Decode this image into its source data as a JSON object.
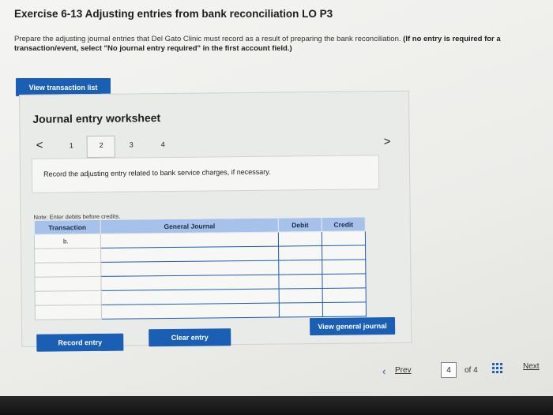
{
  "header": {
    "title": "Exercise 6-13 Adjusting entries from bank reconciliation LO P3",
    "instructions_plain": "Prepare the adjusting journal entries that Del Gato Clinic must record as a result of preparing the bank reconciliation.",
    "instructions_bold": "(If no entry is required for a transaction/event, select \"No journal entry required\" in the first account field.)"
  },
  "buttons": {
    "view_transaction_list": "View transaction list",
    "record_entry": "Record entry",
    "clear_entry": "Clear entry",
    "view_general_journal": "View general journal"
  },
  "worksheet": {
    "title": "Journal entry worksheet",
    "pages": [
      "1",
      "2",
      "3",
      "4"
    ],
    "active_page": "2",
    "prev_arrow": "<",
    "next_arrow": ">",
    "instruction": "Record the adjusting entry related to bank service charges, if necessary.",
    "note": "Note: Enter debits before credits."
  },
  "table": {
    "headers": {
      "transaction": "Transaction",
      "general_journal": "General Journal",
      "debit": "Debit",
      "credit": "Credit"
    },
    "rows": [
      {
        "transaction": "b."
      },
      {
        "transaction": ""
      },
      {
        "transaction": ""
      },
      {
        "transaction": ""
      },
      {
        "transaction": ""
      },
      {
        "transaction": ""
      }
    ]
  },
  "navigation": {
    "prev": "Prev",
    "current_page": "4",
    "of_label": "of 4",
    "next": "Next"
  },
  "colors": {
    "accent": "#1a5fb4",
    "header_blue": "#a7c2ea"
  }
}
